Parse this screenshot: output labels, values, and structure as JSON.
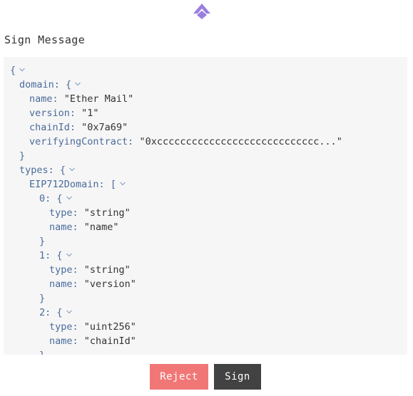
{
  "app": {
    "logo_icon": "diamond-logo-icon",
    "accent_color": "#9b7ee0"
  },
  "header": {
    "title": "Sign Message"
  },
  "message": {
    "open_brace": "{",
    "domain": {
      "key": "domain:",
      "open": "{",
      "name_key": "name:",
      "name_value": "\"Ether Mail\"",
      "version_key": "version:",
      "version_value": "\"1\"",
      "chainId_key": "chainId:",
      "chainId_value": "\"0x7a69\"",
      "verifyingContract_key": "verifyingContract:",
      "verifyingContract_value": "\"0xcccccccccccccccccccccccccccc...\"",
      "close": "}"
    },
    "types": {
      "key": "types:",
      "open": "{",
      "eip712": {
        "key": "EIP712Domain:",
        "open": "[",
        "items": [
          {
            "index": "0:",
            "open": "{",
            "type_key": "type:",
            "type_value": "\"string\"",
            "name_key": "name:",
            "name_value": "\"name\"",
            "close": "}"
          },
          {
            "index": "1:",
            "open": "{",
            "type_key": "type:",
            "type_value": "\"string\"",
            "name_key": "name:",
            "name_value": "\"version\"",
            "close": "}"
          },
          {
            "index": "2:",
            "open": "{",
            "type_key": "type:",
            "type_value": "\"uint256\"",
            "name_key": "name:",
            "name_value": "\"chainId\"",
            "close": "}"
          }
        ]
      }
    }
  },
  "actions": {
    "reject_label": "Reject",
    "sign_label": "Sign"
  }
}
